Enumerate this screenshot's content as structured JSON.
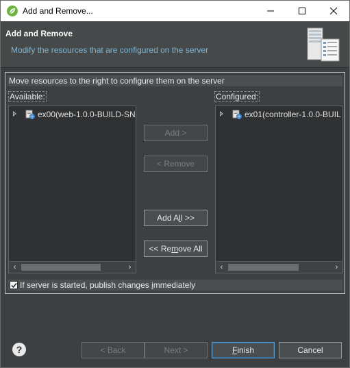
{
  "window": {
    "title": "Add and Remove...",
    "minimize_glyph": "—",
    "maximize_glyph": "☐",
    "close_glyph": "✕"
  },
  "banner": {
    "title": "Add and Remove",
    "description": "Modify the resources that are configured on the server",
    "icon": "server-icon"
  },
  "instruction": "Move resources to the right to configure them on the server",
  "available": {
    "label": "Available:",
    "items": [
      {
        "label": "ex00(web-1.0.0-BUILD-SN",
        "icon": "web-module-icon"
      }
    ]
  },
  "configured": {
    "label": "Configured:",
    "items": [
      {
        "label": "ex01(controller-1.0.0-BUIL",
        "icon": "web-module-icon"
      }
    ]
  },
  "buttons": {
    "add": "Add >",
    "remove": "< Remove",
    "add_all_pre": "Add A",
    "add_all_mn": "l",
    "add_all_post": "l >>",
    "remove_all_pre": "<< Re",
    "remove_all_mn": "m",
    "remove_all_post": "ove All"
  },
  "publish": {
    "checked": true,
    "label_pre": "If server is started, publish changes ",
    "label_mn": "i",
    "label_post": "mmediately"
  },
  "footer": {
    "help": "?",
    "back": "< Back",
    "next": "Next >",
    "finish_mn": "F",
    "finish_rest": "inish",
    "cancel": "Cancel"
  },
  "colors": {
    "background": "#3c4043",
    "banner_desc": "#7eb6d6",
    "default_button_border": "#5a9fd4"
  }
}
